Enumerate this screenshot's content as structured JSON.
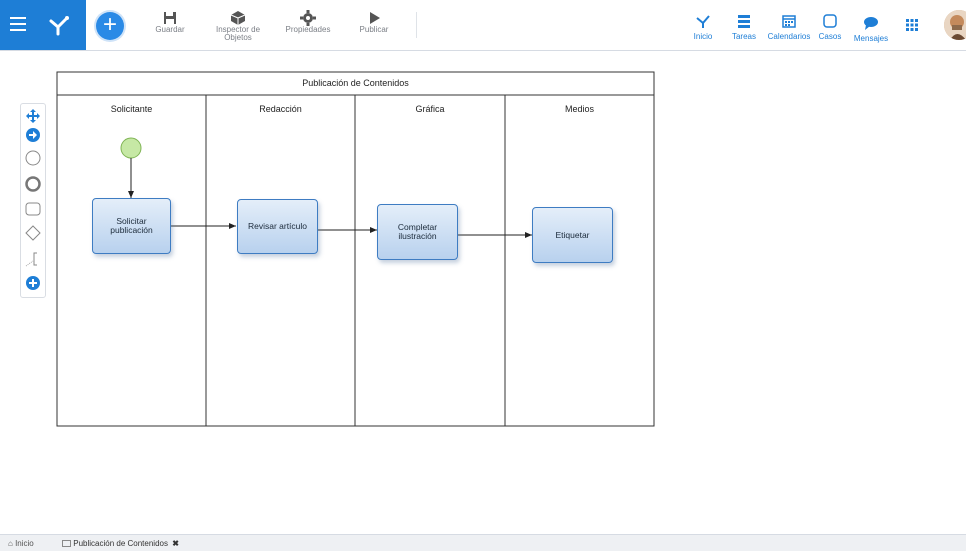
{
  "toolbar": {
    "save_label": "Guardar",
    "inspector_label": "Inspector de Objetos",
    "properties_label": "Propiedades",
    "publish_label": "Publicar"
  },
  "nav": {
    "home": "Inicio",
    "tasks": "Tareas",
    "calendars": "Calendarios",
    "cases": "Casos",
    "messages": "Mensajes"
  },
  "diagram": {
    "pool_title": "Publicación de Contenidos",
    "lanes": [
      "Solicitante",
      "Redacción",
      "Gráfica",
      "Medios"
    ],
    "tasks": [
      {
        "label_lines": [
          "Solicitar",
          "publicación"
        ]
      },
      {
        "label_lines": [
          "Revisar artículo"
        ]
      },
      {
        "label_lines": [
          "Completar",
          "ilustración"
        ]
      },
      {
        "label_lines": [
          "Etiquetar"
        ]
      }
    ]
  },
  "footer": {
    "home_tab": "Inicio",
    "doc_tab": "Publicación de Contenidos"
  },
  "colors": {
    "brand": "#1e7ed6",
    "task_border": "#3e7cc2",
    "start_event": "#c6e8a5"
  }
}
